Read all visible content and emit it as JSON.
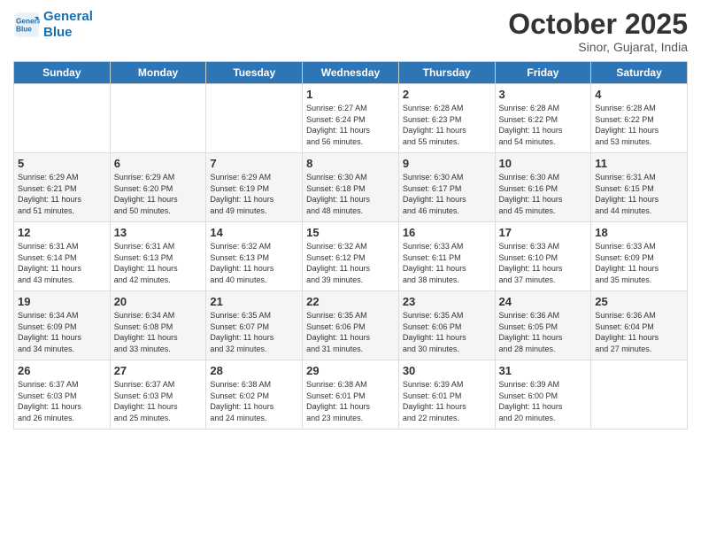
{
  "header": {
    "logo_line1": "General",
    "logo_line2": "Blue",
    "month": "October 2025",
    "location": "Sinor, Gujarat, India"
  },
  "weekdays": [
    "Sunday",
    "Monday",
    "Tuesday",
    "Wednesday",
    "Thursday",
    "Friday",
    "Saturday"
  ],
  "weeks": [
    [
      {
        "day": "",
        "info": ""
      },
      {
        "day": "",
        "info": ""
      },
      {
        "day": "",
        "info": ""
      },
      {
        "day": "1",
        "info": "Sunrise: 6:27 AM\nSunset: 6:24 PM\nDaylight: 11 hours\nand 56 minutes."
      },
      {
        "day": "2",
        "info": "Sunrise: 6:28 AM\nSunset: 6:23 PM\nDaylight: 11 hours\nand 55 minutes."
      },
      {
        "day": "3",
        "info": "Sunrise: 6:28 AM\nSunset: 6:22 PM\nDaylight: 11 hours\nand 54 minutes."
      },
      {
        "day": "4",
        "info": "Sunrise: 6:28 AM\nSunset: 6:22 PM\nDaylight: 11 hours\nand 53 minutes."
      }
    ],
    [
      {
        "day": "5",
        "info": "Sunrise: 6:29 AM\nSunset: 6:21 PM\nDaylight: 11 hours\nand 51 minutes."
      },
      {
        "day": "6",
        "info": "Sunrise: 6:29 AM\nSunset: 6:20 PM\nDaylight: 11 hours\nand 50 minutes."
      },
      {
        "day": "7",
        "info": "Sunrise: 6:29 AM\nSunset: 6:19 PM\nDaylight: 11 hours\nand 49 minutes."
      },
      {
        "day": "8",
        "info": "Sunrise: 6:30 AM\nSunset: 6:18 PM\nDaylight: 11 hours\nand 48 minutes."
      },
      {
        "day": "9",
        "info": "Sunrise: 6:30 AM\nSunset: 6:17 PM\nDaylight: 11 hours\nand 46 minutes."
      },
      {
        "day": "10",
        "info": "Sunrise: 6:30 AM\nSunset: 6:16 PM\nDaylight: 11 hours\nand 45 minutes."
      },
      {
        "day": "11",
        "info": "Sunrise: 6:31 AM\nSunset: 6:15 PM\nDaylight: 11 hours\nand 44 minutes."
      }
    ],
    [
      {
        "day": "12",
        "info": "Sunrise: 6:31 AM\nSunset: 6:14 PM\nDaylight: 11 hours\nand 43 minutes."
      },
      {
        "day": "13",
        "info": "Sunrise: 6:31 AM\nSunset: 6:13 PM\nDaylight: 11 hours\nand 42 minutes."
      },
      {
        "day": "14",
        "info": "Sunrise: 6:32 AM\nSunset: 6:13 PM\nDaylight: 11 hours\nand 40 minutes."
      },
      {
        "day": "15",
        "info": "Sunrise: 6:32 AM\nSunset: 6:12 PM\nDaylight: 11 hours\nand 39 minutes."
      },
      {
        "day": "16",
        "info": "Sunrise: 6:33 AM\nSunset: 6:11 PM\nDaylight: 11 hours\nand 38 minutes."
      },
      {
        "day": "17",
        "info": "Sunrise: 6:33 AM\nSunset: 6:10 PM\nDaylight: 11 hours\nand 37 minutes."
      },
      {
        "day": "18",
        "info": "Sunrise: 6:33 AM\nSunset: 6:09 PM\nDaylight: 11 hours\nand 35 minutes."
      }
    ],
    [
      {
        "day": "19",
        "info": "Sunrise: 6:34 AM\nSunset: 6:09 PM\nDaylight: 11 hours\nand 34 minutes."
      },
      {
        "day": "20",
        "info": "Sunrise: 6:34 AM\nSunset: 6:08 PM\nDaylight: 11 hours\nand 33 minutes."
      },
      {
        "day": "21",
        "info": "Sunrise: 6:35 AM\nSunset: 6:07 PM\nDaylight: 11 hours\nand 32 minutes."
      },
      {
        "day": "22",
        "info": "Sunrise: 6:35 AM\nSunset: 6:06 PM\nDaylight: 11 hours\nand 31 minutes."
      },
      {
        "day": "23",
        "info": "Sunrise: 6:35 AM\nSunset: 6:06 PM\nDaylight: 11 hours\nand 30 minutes."
      },
      {
        "day": "24",
        "info": "Sunrise: 6:36 AM\nSunset: 6:05 PM\nDaylight: 11 hours\nand 28 minutes."
      },
      {
        "day": "25",
        "info": "Sunrise: 6:36 AM\nSunset: 6:04 PM\nDaylight: 11 hours\nand 27 minutes."
      }
    ],
    [
      {
        "day": "26",
        "info": "Sunrise: 6:37 AM\nSunset: 6:03 PM\nDaylight: 11 hours\nand 26 minutes."
      },
      {
        "day": "27",
        "info": "Sunrise: 6:37 AM\nSunset: 6:03 PM\nDaylight: 11 hours\nand 25 minutes."
      },
      {
        "day": "28",
        "info": "Sunrise: 6:38 AM\nSunset: 6:02 PM\nDaylight: 11 hours\nand 24 minutes."
      },
      {
        "day": "29",
        "info": "Sunrise: 6:38 AM\nSunset: 6:01 PM\nDaylight: 11 hours\nand 23 minutes."
      },
      {
        "day": "30",
        "info": "Sunrise: 6:39 AM\nSunset: 6:01 PM\nDaylight: 11 hours\nand 22 minutes."
      },
      {
        "day": "31",
        "info": "Sunrise: 6:39 AM\nSunset: 6:00 PM\nDaylight: 11 hours\nand 20 minutes."
      },
      {
        "day": "",
        "info": ""
      }
    ]
  ]
}
